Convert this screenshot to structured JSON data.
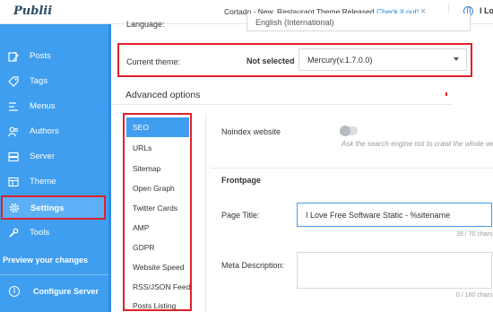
{
  "app": {
    "logo": "Publii"
  },
  "topbar": {
    "notice_text": "Cortado - New, Restaurant Theme Released",
    "notice_link": "Check it out!",
    "close_label": "×",
    "site_label": "I Lo"
  },
  "sidebar": {
    "items": [
      {
        "label": "Posts",
        "icon": "posts-icon"
      },
      {
        "label": "Tags",
        "icon": "tag-icon"
      },
      {
        "label": "Menus",
        "icon": "menu-icon"
      },
      {
        "label": "Authors",
        "icon": "authors-icon"
      },
      {
        "label": "Server",
        "icon": "server-icon"
      },
      {
        "label": "Theme",
        "icon": "theme-icon"
      },
      {
        "label": "Settings",
        "icon": "gear-icon",
        "active": true
      },
      {
        "label": "Tools",
        "icon": "wrench-icon"
      }
    ],
    "preview_label": "Preview your changes",
    "configure_label": "Configure Server",
    "configure_icon_glyph": "i"
  },
  "settings": {
    "language_label": "Language:",
    "language_value": "English (International)",
    "theme_label": "Current theme:",
    "theme_status": "Not selected",
    "theme_value": "Mercury(v.1.7.0.0)",
    "advanced_title": "Advanced options",
    "seo_nav": [
      "SEO",
      "URLs",
      "Sitemap",
      "Open Graph",
      "Twitter Cards",
      "AMP",
      "GDPR",
      "Website Speed",
      "RSS/JSON Feed",
      "Posts Listing"
    ],
    "seo_nav_active": "SEO",
    "noindex_label": "Noindex website",
    "noindex_hint": "Ask the search engine not to crawl the whole we",
    "noindex_enabled": false,
    "frontpage_title": "Frontpage",
    "page_title_label": "Page Title:",
    "page_title_value": "I Love Free Software Static - %sitename",
    "page_title_count": "39 / 70 chars",
    "meta_desc_label": "Meta Description:",
    "meta_desc_value": "",
    "meta_desc_count": "0 / 160 chars"
  },
  "colors": {
    "sidebar": "#3f9ef0",
    "accent": "#1e88e5",
    "highlight_box": "#e0202a"
  }
}
